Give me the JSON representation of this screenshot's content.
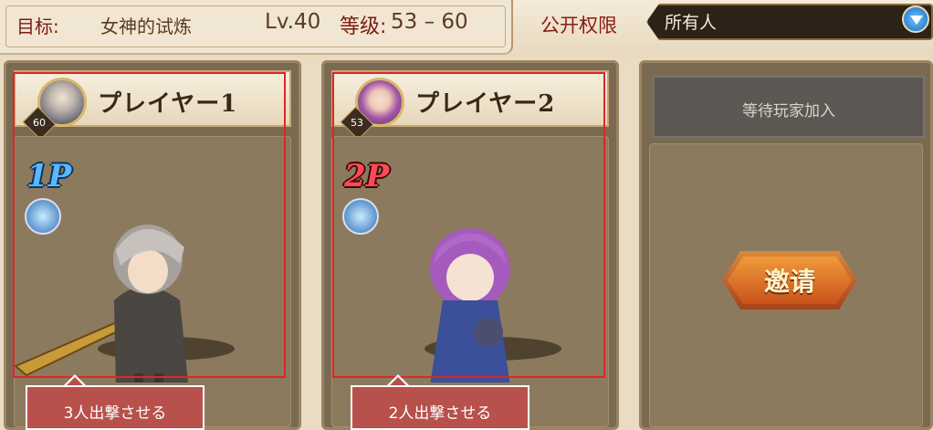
{
  "header": {
    "goal_label": "目标:",
    "goal_value": "女神的试炼",
    "level": "Lv.40",
    "grade_label": "等级:",
    "grade_value": "53 – 60",
    "permission_label": "公开权限",
    "permission_value": "所有人"
  },
  "slots": [
    {
      "name": "プレイヤー1",
      "level": "60",
      "tag": "1P",
      "tag_color": "#3fa0ff",
      "deploy_label": "3人出撃させる"
    },
    {
      "name": "プレイヤー2",
      "level": "53",
      "tag": "2P",
      "tag_color": "#e0283a",
      "deploy_label": "2人出撃させる"
    },
    {
      "waiting_label": "等待玩家加入",
      "invite_label": "邀请"
    }
  ],
  "colors": {
    "accent_red": "#e12525",
    "tooltip": "#b8504c",
    "panel": "#7a6a52"
  }
}
